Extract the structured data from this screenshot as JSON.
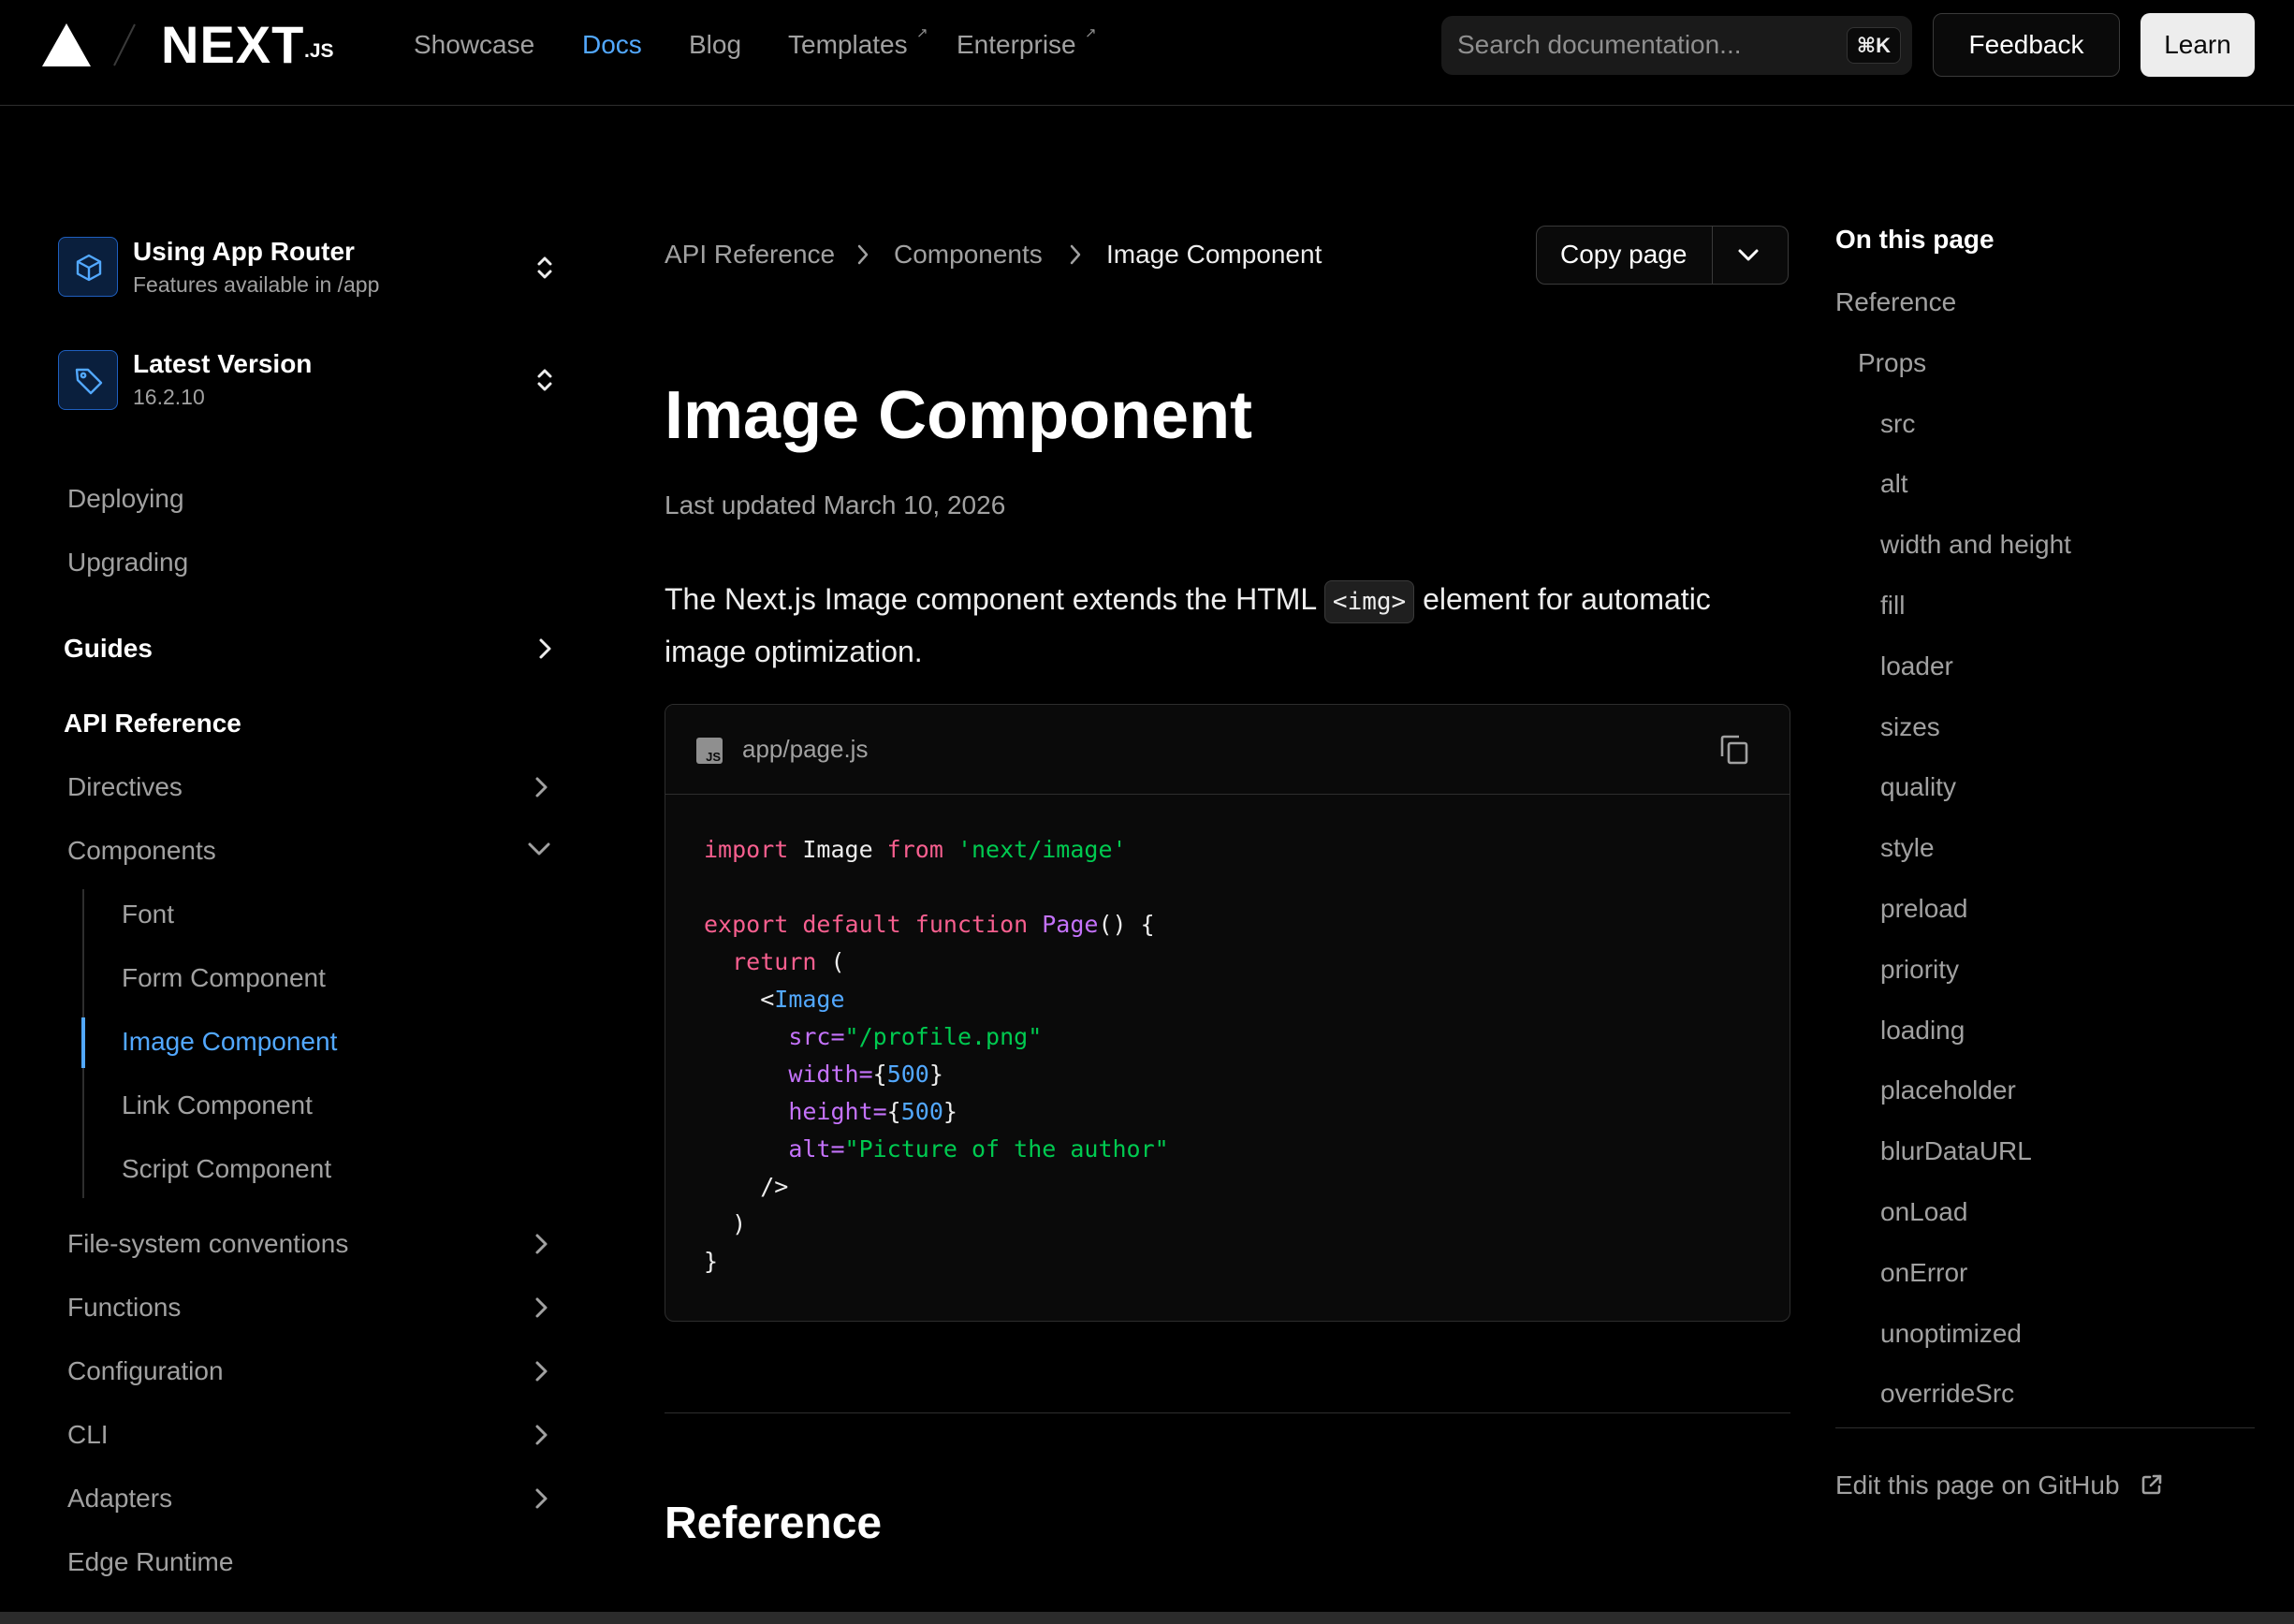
{
  "header": {
    "logo_wordmark": "NEXT",
    "logo_suffix": ".JS",
    "nav": [
      {
        "label": "Showcase"
      },
      {
        "label": "Docs"
      },
      {
        "label": "Blog"
      },
      {
        "label": "Templates"
      },
      {
        "label": "Enterprise"
      }
    ],
    "ext_arrow": "↗",
    "search_placeholder": "Search documentation...",
    "search_shortcut": "⌘K",
    "feedback_label": "Feedback",
    "learn_label": "Learn"
  },
  "sidebar": {
    "router": {
      "title": "Using App Router",
      "subtitle": "Features available in /app"
    },
    "version": {
      "title": "Latest Version",
      "subtitle": "16.2.10"
    },
    "links": [
      "Deploying",
      "Upgrading"
    ],
    "guides": "Guides",
    "api_reference": "API Reference",
    "directives": "Directives",
    "components": "Components",
    "component_items": [
      "Font",
      "Form Component",
      "Image Component",
      "Link Component",
      "Script Component"
    ],
    "more": [
      "File-system conventions",
      "Functions",
      "Configuration",
      "CLI",
      "Adapters",
      "Edge Runtime"
    ]
  },
  "breadcrumb": [
    "API Reference",
    "Components",
    "Image Component"
  ],
  "copy_page_label": "Copy page",
  "page": {
    "title": "Image Component",
    "updated": "Last updated March 10, 2026",
    "intro_before": "The Next.js Image component extends the HTML ",
    "intro_code": "<img>",
    "intro_after": " element for automatic image optimization.",
    "code_filename": "app/page.js",
    "code_badge": "JS",
    "reference_heading": "Reference"
  },
  "code": {
    "l1_import": "import",
    "l1_name": " Image ",
    "l1_from": "from",
    "l1_str": "'next/image'",
    "l3_export": "export default function",
    "l3_fn": "Page",
    "l3_rest": "() {",
    "l4_return": "return",
    "l4_rest": " (",
    "l5_lt": "<",
    "l5_tag": "Image",
    "l6_attr": "src=",
    "l6_val": "\"/profile.png\"",
    "l7_attr": "width=",
    "l7_open": "{",
    "l7_val": "500",
    "l7_close": "}",
    "l8_attr": "height=",
    "l8_open": "{",
    "l8_val": "500",
    "l8_close": "}",
    "l9_attr": "alt=",
    "l9_val": "\"Picture of the author\"",
    "l10": "/>",
    "l11": ")",
    "l12": "}"
  },
  "toc": {
    "title": "On this page",
    "items": [
      "Reference",
      "Props",
      "src",
      "alt",
      "width and height",
      "fill",
      "loader",
      "sizes",
      "quality",
      "style",
      "preload",
      "priority",
      "loading",
      "placeholder",
      "blurDataURL",
      "onLoad",
      "onError",
      "unoptimized",
      "overrideSrc"
    ],
    "edit": "Edit this page on GitHub"
  },
  "colors": {
    "accent": "#52a8ff",
    "keyword": "#f75f8f",
    "string": "#00ca50",
    "function": "#c472fb"
  }
}
